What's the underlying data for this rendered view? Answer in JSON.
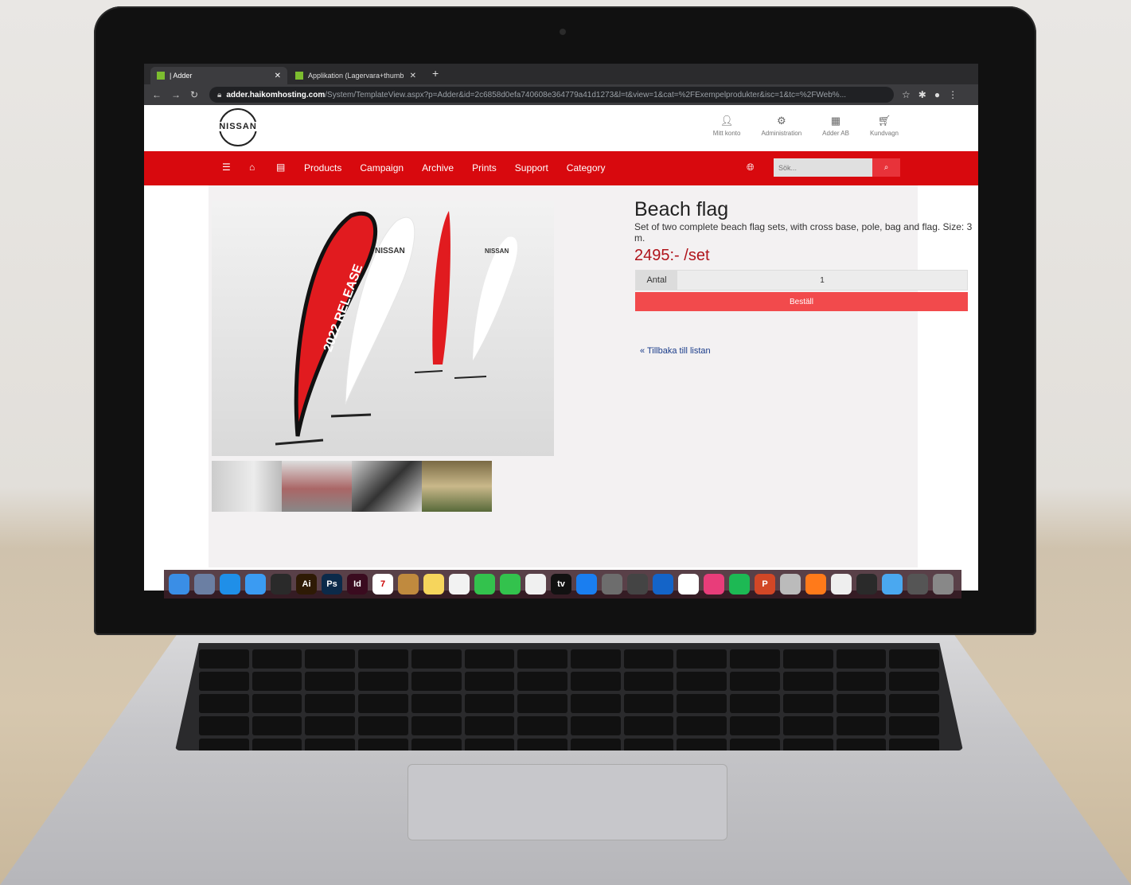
{
  "browser": {
    "tabs": [
      {
        "title": "| Adder",
        "active": true
      },
      {
        "title": "Applikation (Lagervara+thumb",
        "active": false
      }
    ],
    "url_host": "adder.haikomhosting.com",
    "url_path": "/System/TemplateView.aspx?p=Adder&id=2c6858d0efa740608e364779a41d1273&l=t&view=1&cat=%2FExempelprodukter&isc=1&tc=%2FWeb%..."
  },
  "site": {
    "logo_text": "NISSAN",
    "header_links": [
      {
        "label": "Mitt konto",
        "icon": "user-icon"
      },
      {
        "label": "Administration",
        "icon": "gears-icon"
      },
      {
        "label": "Adder AB",
        "icon": "building-icon"
      },
      {
        "label": "Kundvagn",
        "icon": "cart-icon"
      }
    ],
    "menu": [
      "Products",
      "Campaign",
      "Archive",
      "Prints",
      "Support",
      "Category"
    ],
    "search_placeholder": "Sök...",
    "colors": {
      "brand_red": "#d8090e",
      "order_button": "#f24a4c",
      "price": "#b0141b"
    }
  },
  "product": {
    "title": "Beach flag",
    "description": "Set of two complete beach flag sets, with cross base, pole, bag and flag. Size: 3 m.",
    "price": "2495:- /set",
    "quantity_label": "Antal",
    "quantity_value": "1",
    "order_label": "Beställ",
    "back_link": "« Tillbaka till listan",
    "flag_texts": {
      "release": "2022 RELEASE",
      "brand": "NISSAN"
    }
  },
  "dock": {
    "apps": [
      {
        "label": "",
        "color": "#3a8ee6",
        "name": "finder-icon"
      },
      {
        "label": "",
        "color": "#6b7fa3",
        "name": "preview-icon"
      },
      {
        "label": "",
        "color": "#1f8fe8",
        "name": "safari-icon"
      },
      {
        "label": "",
        "color": "#3b9bf2",
        "name": "mail-icon"
      },
      {
        "label": "",
        "color": "#2a2a2a",
        "name": "acrobat-icon"
      },
      {
        "label": "Ai",
        "color": "#2e1a05",
        "name": "illustrator-icon"
      },
      {
        "label": "Ps",
        "color": "#0b2a4a",
        "name": "photoshop-icon"
      },
      {
        "label": "Id",
        "color": "#3a0b1f",
        "name": "indesign-icon"
      },
      {
        "label": "7",
        "color": "#ffffff",
        "name": "calendar-icon"
      },
      {
        "label": "",
        "color": "#c08a3e",
        "name": "contacts-icon"
      },
      {
        "label": "",
        "color": "#f6d55c",
        "name": "notes-icon"
      },
      {
        "label": "",
        "color": "#f2f2f2",
        "name": "reminders-icon"
      },
      {
        "label": "",
        "color": "#33c24d",
        "name": "messages-icon"
      },
      {
        "label": "",
        "color": "#33c24d",
        "name": "facetime-icon"
      },
      {
        "label": "",
        "color": "#f0f0f0",
        "name": "numbers-icon"
      },
      {
        "label": "tv",
        "color": "#111111",
        "name": "appletv-icon"
      },
      {
        "label": "",
        "color": "#1a7ef0",
        "name": "appstore-icon"
      },
      {
        "label": "",
        "color": "#6d6d6d",
        "name": "settings-icon"
      },
      {
        "label": "",
        "color": "#444444",
        "name": "calculator-icon"
      },
      {
        "label": "",
        "color": "#1464c8",
        "name": "outlook-icon"
      },
      {
        "label": "",
        "color": "#ffffff",
        "name": "chrome-icon"
      },
      {
        "label": "",
        "color": "#e83d7a",
        "name": "creative-cloud-icon"
      },
      {
        "label": "",
        "color": "#1db954",
        "name": "spotify-icon"
      },
      {
        "label": "P",
        "color": "#d24726",
        "name": "powerpoint-icon"
      },
      {
        "label": "",
        "color": "#bbbbbb",
        "name": "fontbook-icon"
      },
      {
        "label": "",
        "color": "#ff7a1a",
        "name": "firefox-icon"
      },
      {
        "label": "",
        "color": "#eeeeee",
        "name": "document-icon"
      },
      {
        "label": "",
        "color": "#2a2a2a",
        "name": "pdf-icon"
      },
      {
        "label": "",
        "color": "#4aa8f0",
        "name": "folder-icon"
      },
      {
        "label": "",
        "color": "#555555",
        "name": "keyboard-icon"
      },
      {
        "label": "",
        "color": "#888888",
        "name": "trash-icon"
      }
    ]
  }
}
